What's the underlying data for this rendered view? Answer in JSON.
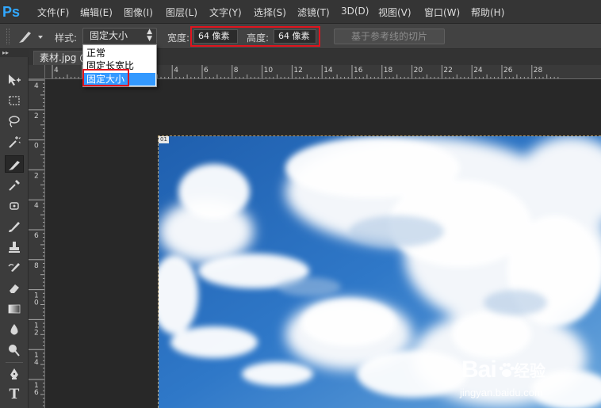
{
  "app": {
    "logo": "Ps"
  },
  "menu": [
    {
      "id": "file",
      "label": "文件(F)"
    },
    {
      "id": "edit",
      "label": "编辑(E)"
    },
    {
      "id": "image",
      "label": "图像(I)"
    },
    {
      "id": "layer",
      "label": "图层(L)"
    },
    {
      "id": "type",
      "label": "文字(Y)"
    },
    {
      "id": "select",
      "label": "选择(S)"
    },
    {
      "id": "filter",
      "label": "滤镜(T)"
    },
    {
      "id": "3d",
      "label": "3D(D)"
    },
    {
      "id": "view",
      "label": "视图(V)"
    },
    {
      "id": "window",
      "label": "窗口(W)"
    },
    {
      "id": "help",
      "label": "帮助(H)"
    }
  ],
  "options": {
    "style_label": "样式:",
    "style_value": "固定大小",
    "width_label": "宽度:",
    "width_value": "64 像素",
    "height_label": "高度:",
    "height_value": "64 像素",
    "slices_button": "基于参考线的切片"
  },
  "style_dropdown": {
    "items": [
      "正常",
      "固定长宽比",
      "固定大小"
    ],
    "selected": "固定大小"
  },
  "document": {
    "tab_label": "素材.jpg @"
  },
  "slice_badge": "01",
  "ruler": {
    "top_labels": [
      "4",
      "2",
      "0",
      "2",
      "4",
      "6",
      "8",
      "10",
      "12",
      "14",
      "16",
      "18",
      "20",
      "22",
      "24",
      "26",
      "28"
    ],
    "left_labels": [
      "4",
      "2",
      "0",
      "2",
      "4",
      "6",
      "8",
      "10",
      "12",
      "14",
      "16"
    ]
  },
  "watermark": {
    "brand": "Bai",
    "jingyan": "经验",
    "url": "jingyan.baidu.com"
  },
  "colors": {
    "menubar_bg": "#353535",
    "options_bg": "#424242",
    "toolbox_bg": "#3c3c3c",
    "canvas_bg": "#282828",
    "logo": "#31a8ff",
    "highlight": "#e0141e",
    "dropdown_selected": "#3399ff"
  }
}
